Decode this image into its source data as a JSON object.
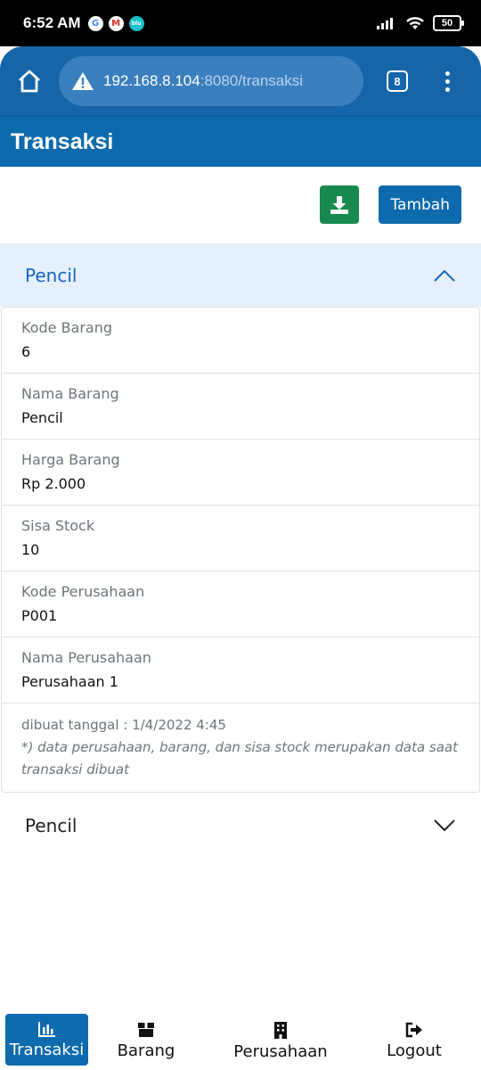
{
  "status": {
    "time": "6:52 AM",
    "battery": "50"
  },
  "browser": {
    "url_host": "192.168.8.104",
    "url_path": ":8080/transaksi",
    "tab_count": "8"
  },
  "page": {
    "title": "Transaksi",
    "add_label": "Tambah"
  },
  "transactions": [
    {
      "title": "Pencil",
      "expanded": true,
      "fields": [
        {
          "label": "Kode Barang",
          "value": "6"
        },
        {
          "label": "Nama Barang",
          "value": "Pencil"
        },
        {
          "label": "Harga Barang",
          "value": "Rp 2.000"
        },
        {
          "label": "Sisa Stock",
          "value": "10"
        },
        {
          "label": "Kode Perusahaan",
          "value": "P001"
        },
        {
          "label": "Nama Perusahaan",
          "value": "Perusahaan 1"
        }
      ],
      "created": "dibuat tanggal : 1/4/2022 4:45",
      "note": "*) data perusahaan, barang, dan sisa stock merupakan data saat transaksi dibuat"
    },
    {
      "title": "Pencil",
      "expanded": false
    }
  ],
  "nav": [
    {
      "label": "Transaksi",
      "icon": "chart-icon",
      "active": true
    },
    {
      "label": "Barang",
      "icon": "box-icon",
      "active": false
    },
    {
      "label": "Perusahaan",
      "icon": "building-icon",
      "active": false
    },
    {
      "label": "Logout",
      "icon": "logout-icon",
      "active": false
    }
  ],
  "colors": {
    "primary": "#0d6aad",
    "success": "#188a4f",
    "accordion_open": "#e6f0fc"
  }
}
